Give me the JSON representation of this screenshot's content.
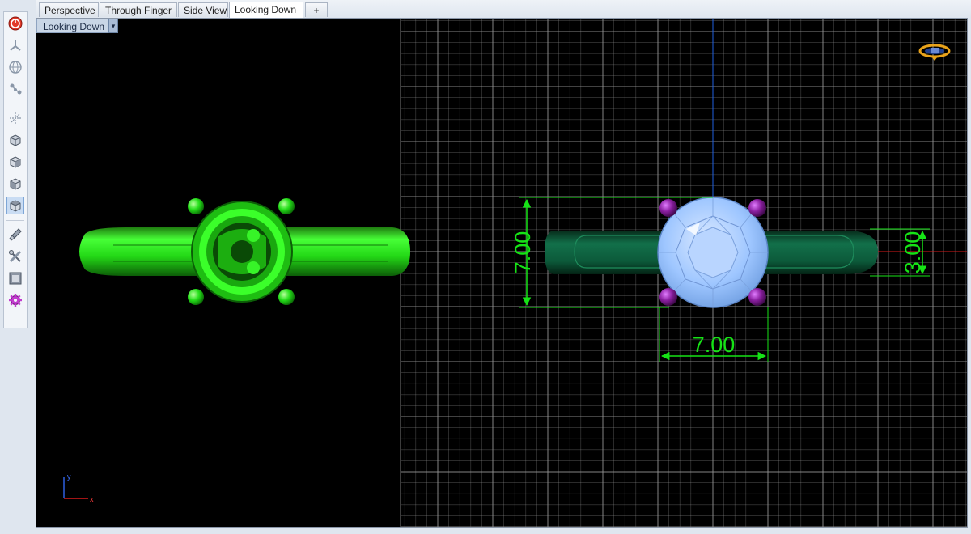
{
  "tabs": [
    {
      "label": "Perspective"
    },
    {
      "label": "Through Finger"
    },
    {
      "label": "Side View"
    },
    {
      "label": "Looking Down",
      "active": true
    }
  ],
  "add_tab_label": "+",
  "viewport": {
    "title": "Looking Down",
    "dropdown_glyph": "▾"
  },
  "dimensions": {
    "height": "7.00",
    "width": "7.00",
    "band": "3.00"
  },
  "axes": {
    "x": "x",
    "y": "y"
  },
  "colors": {
    "ring_green": "#25e01a",
    "ring_dark": "#0d5a38",
    "gem": "#9ec6ff",
    "prong": "#8a1fa0",
    "dimension": "#16e316",
    "grid": "#9a9a9a"
  },
  "toolbar": {
    "items": [
      {
        "icon": "power-icon"
      },
      {
        "icon": "axis-tripod-icon"
      },
      {
        "icon": "globe-icon"
      },
      {
        "icon": "molecule-icon"
      },
      {
        "icon": "snap-axis-icon"
      },
      {
        "icon": "box-front-icon"
      },
      {
        "icon": "box-side-icon"
      },
      {
        "icon": "box-iso-icon"
      },
      {
        "icon": "box-top-icon",
        "selected": true
      },
      {
        "icon": "brush-icon"
      },
      {
        "icon": "tools-icon"
      },
      {
        "icon": "render-icon"
      },
      {
        "icon": "gear-icon"
      }
    ]
  }
}
